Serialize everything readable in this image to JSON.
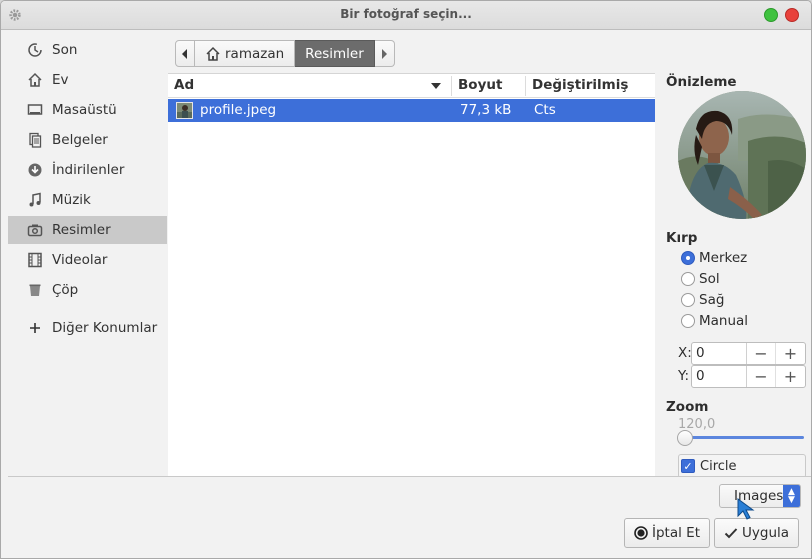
{
  "window": {
    "title": "Bir fotoğraf seçin..."
  },
  "sidebar": {
    "items": [
      {
        "label": "Son",
        "icon": "clock-icon"
      },
      {
        "label": "Ev",
        "icon": "home-icon"
      },
      {
        "label": "Masaüstü",
        "icon": "desktop-icon"
      },
      {
        "label": "Belgeler",
        "icon": "documents-icon"
      },
      {
        "label": "İndirilenler",
        "icon": "download-icon"
      },
      {
        "label": "Müzik",
        "icon": "music-icon"
      },
      {
        "label": "Resimler",
        "icon": "camera-icon",
        "active": true
      },
      {
        "label": "Videolar",
        "icon": "film-icon"
      },
      {
        "label": "Çöp",
        "icon": "trash-icon"
      },
      {
        "label": "Diğer Konumlar",
        "icon": "plus-icon"
      }
    ]
  },
  "pathbar": {
    "crumbs": [
      "ramazan",
      "Resimler"
    ],
    "active": "Resimler"
  },
  "filelist": {
    "columns": [
      "Ad",
      "Boyut",
      "Değiştirilmiş"
    ],
    "rows": [
      {
        "name": "profile.jpeg",
        "size": "77,3 kB",
        "modified": "Cts"
      }
    ]
  },
  "preview": {
    "title": "Önizleme",
    "crop_title": "Kırp",
    "crop_options": [
      "Merkez",
      "Sol",
      "Sağ",
      "Manual"
    ],
    "crop_selected": "Merkez",
    "x_label": "X:",
    "x_value": "0",
    "y_label": "Y:",
    "y_value": "0",
    "zoom_title": "Zoom",
    "zoom_value": "120,0",
    "circle_label": "Circle",
    "circle_checked": true
  },
  "footer": {
    "filter": "Images",
    "cancel": "İptal Et",
    "apply": "Uygula"
  },
  "colors": {
    "accent": "#3d6fd9",
    "selection": "#3d6fd9"
  }
}
